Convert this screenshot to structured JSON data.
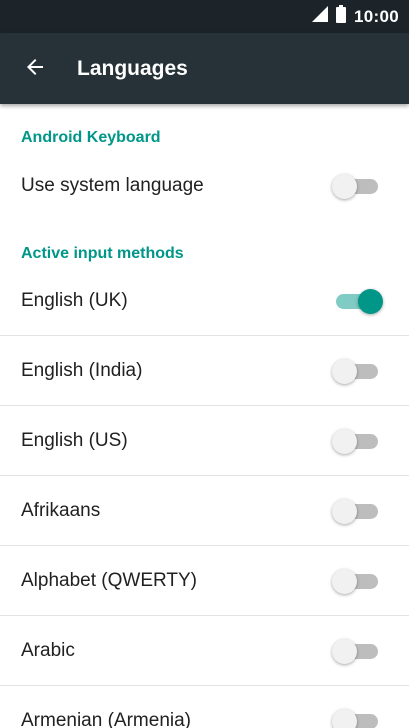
{
  "status_bar": {
    "time": "10:00"
  },
  "app_bar": {
    "title": "Languages"
  },
  "sections": [
    {
      "header": "Android Keyboard"
    },
    {
      "header": "Active input methods"
    }
  ],
  "settings": {
    "use_system_language": {
      "label": "Use system language",
      "enabled": false
    }
  },
  "languages": [
    {
      "label": "English (UK)",
      "enabled": true
    },
    {
      "label": "English (India)",
      "enabled": false
    },
    {
      "label": "English (US)",
      "enabled": false
    },
    {
      "label": "Afrikaans",
      "enabled": false
    },
    {
      "label": "Alphabet (QWERTY)",
      "enabled": false
    },
    {
      "label": "Arabic",
      "enabled": false
    },
    {
      "label": "Armenian (Armenia)",
      "enabled": false
    }
  ],
  "colors": {
    "accent": "#009688",
    "app_bar": "#263238",
    "status_bar": "#1c2429"
  }
}
